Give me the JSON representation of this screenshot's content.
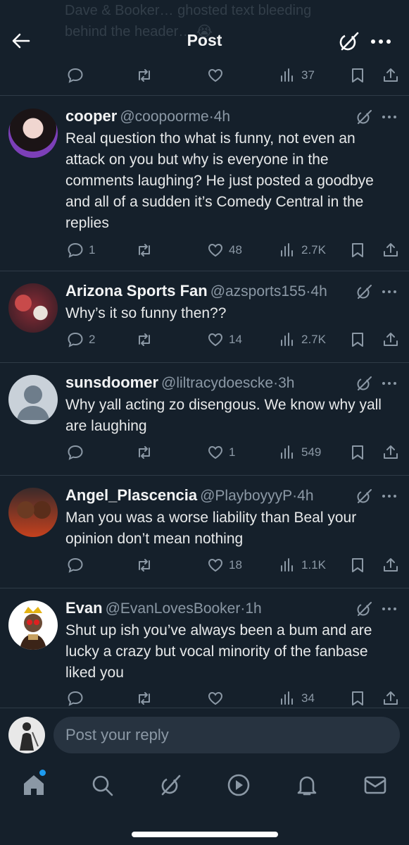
{
  "header": {
    "title": "Post",
    "ghost_text": "Dave & Booker… ghosted text bleeding\nbehind the header… 😭"
  },
  "top_actions": {
    "views": "37"
  },
  "tweets": [
    {
      "name": "cooper",
      "handle": "@coopoorme",
      "time": "4h",
      "text": "Real question tho what is funny, not even an attack on you but why is everyone in the comments laughing? He just posted a goodbye and all of a sudden it’s Comedy Central in the replies",
      "replies": "1",
      "reposts": "",
      "likes": "48",
      "views": "2.7K"
    },
    {
      "name": "Arizona Sports Fan",
      "handle": "@azsports155",
      "time": "4h",
      "text": "Why’s it so funny then??",
      "replies": "2",
      "reposts": "",
      "likes": "14",
      "views": "2.7K"
    },
    {
      "name": "sunsdoomer",
      "handle": "@liltracydoescke",
      "time": "3h",
      "text": "Why yall acting zo disengous. We know why yall are laughing",
      "replies": "",
      "reposts": "",
      "likes": "1",
      "views": "549"
    },
    {
      "name": "Angel_Plascencia",
      "handle": "@PlayboyyyP",
      "time": "4h",
      "text": "Man you was a worse liability than Beal your opinion don’t mean nothing",
      "replies": "",
      "reposts": "",
      "likes": "18",
      "views": "1.1K"
    },
    {
      "name": "Evan",
      "handle": "@EvanLovesBooker",
      "time": "1h",
      "text": "Shut up ish you’ve always been a bum and are lucky a crazy but vocal minority of the fanbase liked you",
      "replies": "",
      "reposts": "",
      "likes": "",
      "views": "34"
    }
  ],
  "reply_bar": {
    "placeholder": "Post your reply"
  },
  "icons": {
    "back": "back-arrow-icon",
    "grok": "grok-icon",
    "more": "more-icon",
    "reply": "reply-icon",
    "repost": "repost-icon",
    "like": "like-icon",
    "views": "views-icon",
    "bookmark": "bookmark-icon",
    "share": "share-icon",
    "home": "home-icon",
    "search": "search-icon",
    "play": "play-icon",
    "notifications": "bell-icon",
    "messages": "mail-icon"
  },
  "colors": {
    "background": "#15202b",
    "text": "#e7e9ea",
    "muted": "#8b98a5",
    "accent": "#1d9bf0",
    "divider": "#2f3b47"
  }
}
